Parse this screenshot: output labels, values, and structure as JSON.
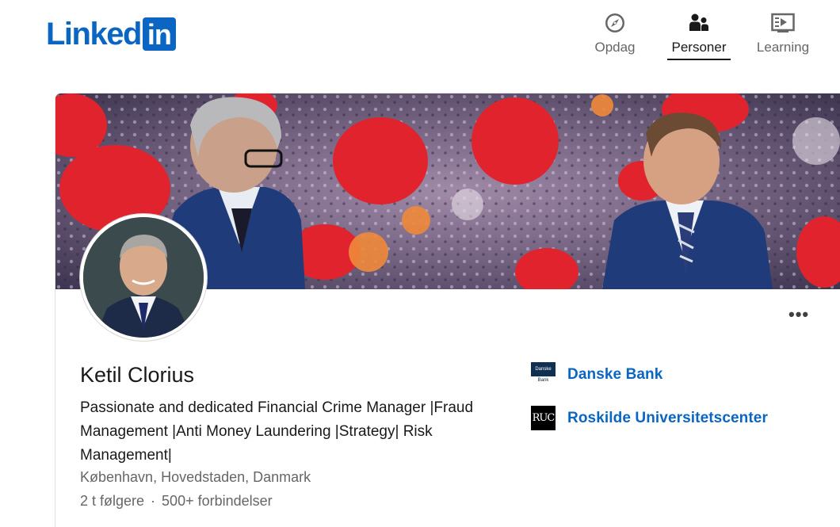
{
  "header": {
    "logo_text": "Linked",
    "logo_box_text": "in",
    "nav": [
      {
        "label": "Opdag",
        "icon": "compass-icon",
        "active": false
      },
      {
        "label": "Personer",
        "icon": "people-icon",
        "active": true
      },
      {
        "label": "Learning",
        "icon": "learning-icon",
        "active": false
      }
    ]
  },
  "profile": {
    "more_label": "•••",
    "name": "Ketil Clorius",
    "headline": "Passionate and dedicated Financial Crime Manager |Fraud Management |Anti Money Laundering |Strategy| Risk Management|",
    "location": "København, Hovedstaden, Danmark",
    "followers": "2 t følgere",
    "separator": "·",
    "connections": "500+ forbindelser"
  },
  "affiliations": [
    {
      "name": "Danske Bank",
      "logo_text_top": "Danske",
      "logo_text_bottom": "Bank"
    },
    {
      "name": "Roskilde Universitetscenter",
      "logo_text": "RUC"
    }
  ],
  "colors": {
    "brand": "#0a66c2",
    "text_primary": "#191919",
    "text_secondary": "#666666"
  }
}
